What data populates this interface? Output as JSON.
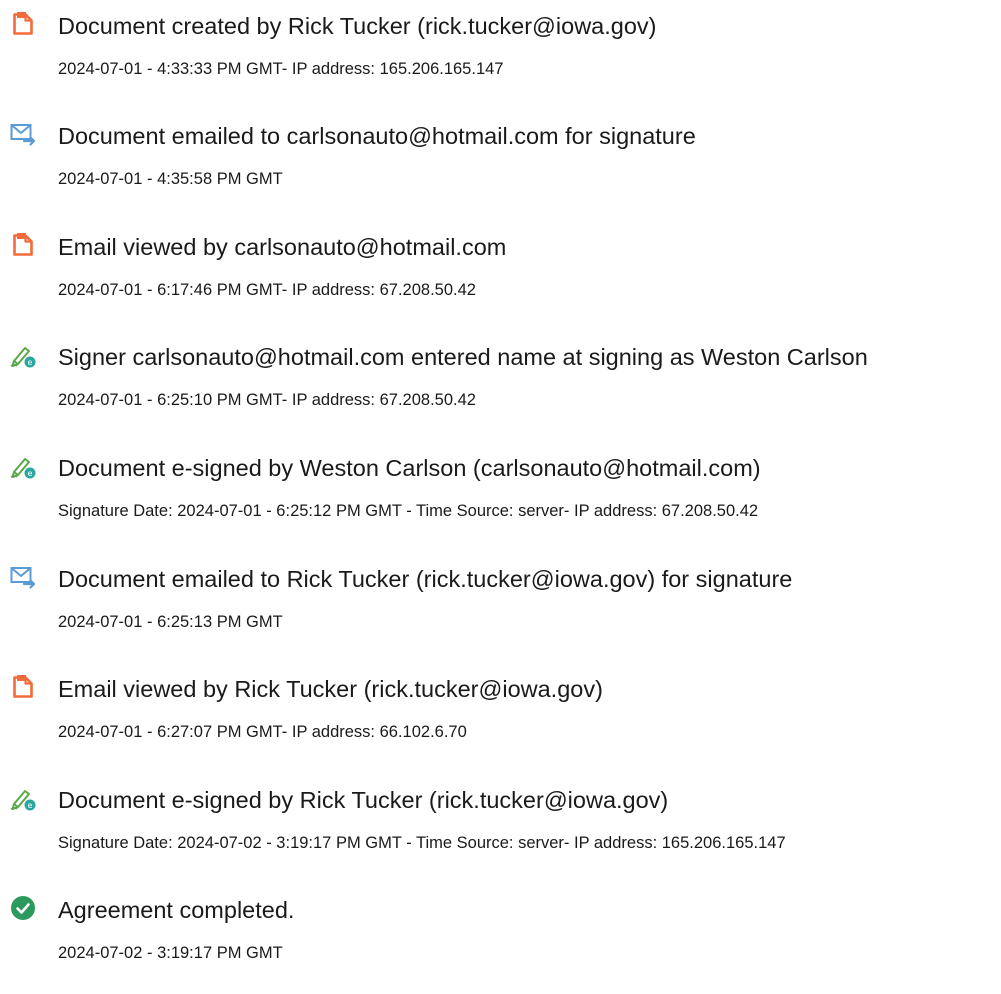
{
  "events": [
    {
      "icon": "document-icon",
      "title": "Document created by Rick Tucker (rick.tucker@iowa.gov)",
      "detail": "2024-07-01 - 4:33:33 PM GMT- IP address: 165.206.165.147"
    },
    {
      "icon": "email-icon",
      "title": "Document emailed to carlsonauto@hotmail.com for signature",
      "detail": "2024-07-01 - 4:35:58 PM GMT"
    },
    {
      "icon": "document-icon",
      "title": "Email viewed by carlsonauto@hotmail.com",
      "detail": "2024-07-01 - 6:17:46 PM GMT- IP address: 67.208.50.42"
    },
    {
      "icon": "e-sign-pen-icon",
      "title": "Signer carlsonauto@hotmail.com entered name at signing as Weston Carlson",
      "detail": "2024-07-01 - 6:25:10 PM GMT- IP address: 67.208.50.42"
    },
    {
      "icon": "e-sign-pen-icon",
      "title": "Document e-signed by Weston Carlson (carlsonauto@hotmail.com)",
      "detail": "Signature Date: 2024-07-01 - 6:25:12 PM GMT - Time Source: server- IP address: 67.208.50.42"
    },
    {
      "icon": "email-icon",
      "title": "Document emailed to Rick Tucker (rick.tucker@iowa.gov) for signature",
      "detail": "2024-07-01 - 6:25:13 PM GMT"
    },
    {
      "icon": "document-icon",
      "title": "Email viewed by Rick Tucker (rick.tucker@iowa.gov)",
      "detail": "2024-07-01 - 6:27:07 PM GMT- IP address: 66.102.6.70"
    },
    {
      "icon": "e-sign-pen-icon",
      "title": "Document e-signed by Rick Tucker (rick.tucker@iowa.gov)",
      "detail": "Signature Date: 2024-07-02 - 3:19:17 PM GMT - Time Source: server- IP address: 165.206.165.147"
    },
    {
      "icon": "check-circle-icon",
      "title": "Agreement completed.",
      "detail": "2024-07-02 - 3:19:17 PM GMT"
    }
  ],
  "colors": {
    "document_icon": "#f26b3a",
    "email_icon": "#5b9bd5",
    "e_sign_pen_icon": "#5aa84a",
    "e_sign_badge": "#2aa7a0",
    "check_circle_icon": "#2c9a5f",
    "text": "#1a1a1a"
  }
}
